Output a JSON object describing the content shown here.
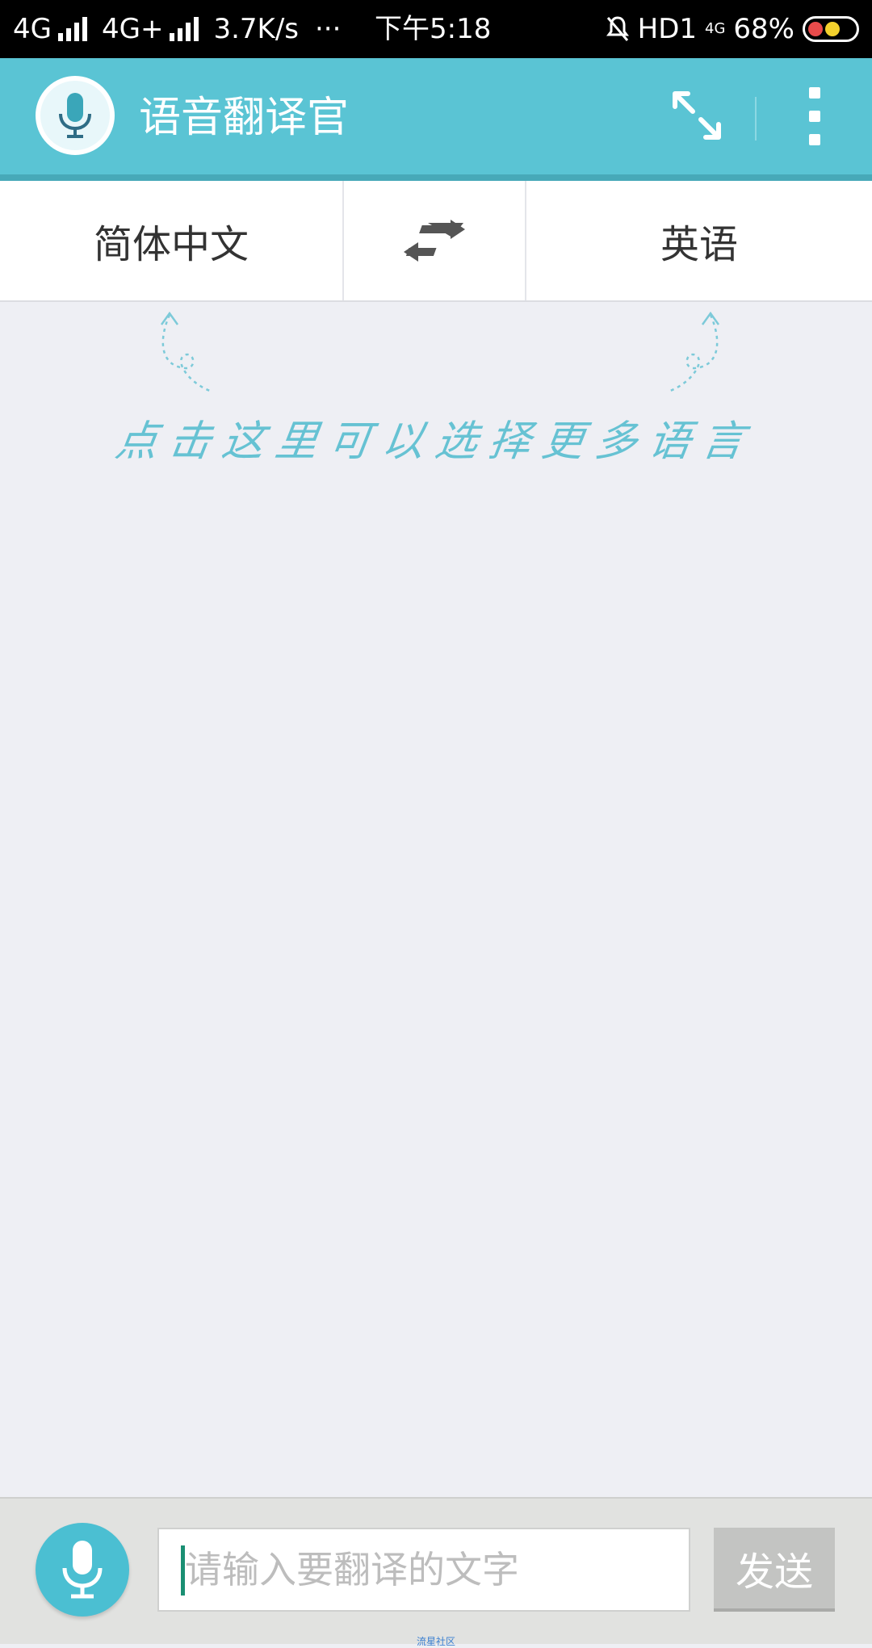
{
  "status_bar": {
    "network1": "4G",
    "network2": "4G+",
    "speed": "3.7K/s",
    "more": "···",
    "time": "下午5:18",
    "hd": "HD1",
    "net3": "4G",
    "battery_pct": "68%"
  },
  "app_bar": {
    "title": "语音翻译官",
    "logo_icon": "microphone-chat-icon",
    "expand_icon": "expand-icon",
    "more_icon": "more-vertical-icon"
  },
  "languages": {
    "source": "简体中文",
    "swap_icon": "swap-arrows-icon",
    "target": "英语"
  },
  "hint": {
    "text": "点击这里可以选择更多语言"
  },
  "input_bar": {
    "mic_icon": "microphone-icon",
    "placeholder": "请输入要翻译的文字",
    "send_label": "发送",
    "watermark": "流星社区"
  },
  "colors": {
    "accent": "#5ac4d4",
    "hint": "#66c2d3",
    "mic": "#4bbfd2",
    "send_disabled": "#c3c4c2"
  }
}
